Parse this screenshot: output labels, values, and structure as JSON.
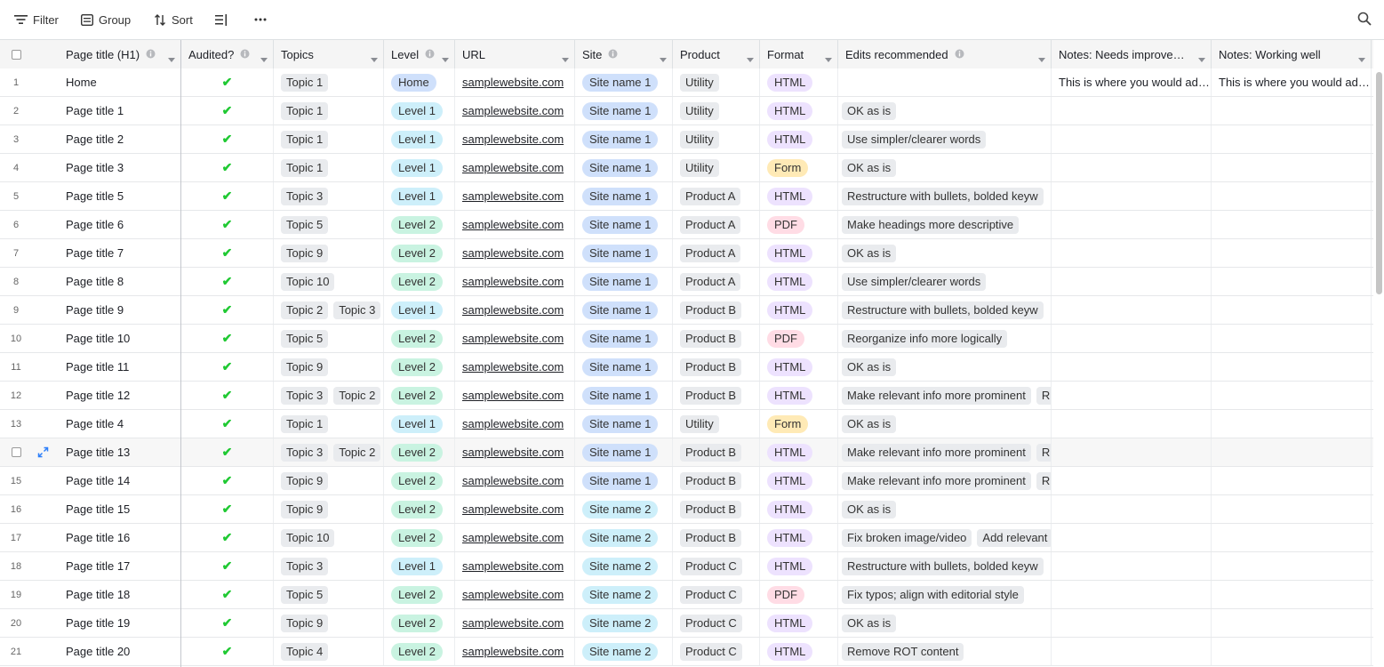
{
  "toolbar": {
    "filter_label": "Filter",
    "group_label": "Group",
    "sort_label": "Sort"
  },
  "columns": [
    {
      "key": "title",
      "label": "Page title (H1)",
      "info": true
    },
    {
      "key": "audited",
      "label": "Audited?",
      "info": true
    },
    {
      "key": "topics",
      "label": "Topics",
      "info": false
    },
    {
      "key": "level",
      "label": "Level",
      "info": true
    },
    {
      "key": "url",
      "label": "URL",
      "info": false
    },
    {
      "key": "site",
      "label": "Site",
      "info": true
    },
    {
      "key": "product",
      "label": "Product",
      "info": false
    },
    {
      "key": "format",
      "label": "Format",
      "info": false
    },
    {
      "key": "edits",
      "label": "Edits recommended",
      "info": true
    },
    {
      "key": "needs",
      "label": "Notes: Needs improvement",
      "info": false
    },
    {
      "key": "working",
      "label": "Notes: Working well",
      "info": false
    }
  ],
  "colors": {
    "level": {
      "Home": "#cfe0fb",
      "Level 1": "#cdeffa",
      "Level 2": "#c9f3e1"
    },
    "site": {
      "Site name 1": "#cfe0fb",
      "Site name 2": "#cdeffa"
    },
    "format": {
      "HTML": "#ede2fe",
      "PDF": "#ffdce5",
      "Form": "#ffeab6"
    },
    "check": "#20c933"
  },
  "rows": [
    {
      "num": "1",
      "title": "Home",
      "audited": true,
      "topics": [
        "Topic 1"
      ],
      "level": "Home",
      "url": "samplewebsite.com",
      "site": "Site name 1",
      "product": "Utility",
      "format": "HTML",
      "edits": [],
      "needs": "This is where you would add notes",
      "working": "This is where you would add notes"
    },
    {
      "num": "2",
      "title": "Page title 1",
      "audited": true,
      "topics": [
        "Topic 1"
      ],
      "level": "Level 1",
      "url": "samplewebsite.com",
      "site": "Site name 1",
      "product": "Utility",
      "format": "HTML",
      "edits": [
        "OK as is"
      ],
      "needs": "",
      "working": ""
    },
    {
      "num": "3",
      "title": "Page title 2",
      "audited": true,
      "topics": [
        "Topic 1"
      ],
      "level": "Level 1",
      "url": "samplewebsite.com",
      "site": "Site name 1",
      "product": "Utility",
      "format": "HTML",
      "edits": [
        "Use simpler/clearer words"
      ],
      "needs": "",
      "working": ""
    },
    {
      "num": "4",
      "title": "Page title 3",
      "audited": true,
      "topics": [
        "Topic 1"
      ],
      "level": "Level 1",
      "url": "samplewebsite.com",
      "site": "Site name 1",
      "product": "Utility",
      "format": "Form",
      "edits": [
        "OK as is"
      ],
      "needs": "",
      "working": ""
    },
    {
      "num": "5",
      "title": "Page title 5",
      "audited": true,
      "topics": [
        "Topic 3"
      ],
      "level": "Level 1",
      "url": "samplewebsite.com",
      "site": "Site name 1",
      "product": "Product A",
      "format": "HTML",
      "edits": [
        "Restructure with bullets, bolded keyw"
      ],
      "needs": "",
      "working": ""
    },
    {
      "num": "6",
      "title": "Page title 6",
      "audited": true,
      "topics": [
        "Topic 5"
      ],
      "level": "Level 2",
      "url": "samplewebsite.com",
      "site": "Site name 1",
      "product": "Product A",
      "format": "PDF",
      "edits": [
        "Make headings more descriptive"
      ],
      "needs": "",
      "working": ""
    },
    {
      "num": "7",
      "title": "Page title 7",
      "audited": true,
      "topics": [
        "Topic 9"
      ],
      "level": "Level 2",
      "url": "samplewebsite.com",
      "site": "Site name 1",
      "product": "Product A",
      "format": "HTML",
      "edits": [
        "OK as is"
      ],
      "needs": "",
      "working": ""
    },
    {
      "num": "8",
      "title": "Page title 8",
      "audited": true,
      "topics": [
        "Topic 10"
      ],
      "level": "Level 2",
      "url": "samplewebsite.com",
      "site": "Site name 1",
      "product": "Product A",
      "format": "HTML",
      "edits": [
        "Use simpler/clearer words"
      ],
      "needs": "",
      "working": ""
    },
    {
      "num": "9",
      "title": "Page title 9",
      "audited": true,
      "topics": [
        "Topic 2",
        "Topic 3"
      ],
      "level": "Level 1",
      "url": "samplewebsite.com",
      "site": "Site name 1",
      "product": "Product B",
      "format": "HTML",
      "edits": [
        "Restructure with bullets, bolded keyw"
      ],
      "needs": "",
      "working": ""
    },
    {
      "num": "10",
      "title": "Page title 10",
      "audited": true,
      "topics": [
        "Topic 5"
      ],
      "level": "Level 2",
      "url": "samplewebsite.com",
      "site": "Site name 1",
      "product": "Product B",
      "format": "PDF",
      "edits": [
        "Reorganize info more logically"
      ],
      "needs": "",
      "working": ""
    },
    {
      "num": "11",
      "title": "Page title 11",
      "audited": true,
      "topics": [
        "Topic 9"
      ],
      "level": "Level 2",
      "url": "samplewebsite.com",
      "site": "Site name 1",
      "product": "Product B",
      "format": "HTML",
      "edits": [
        "OK as is"
      ],
      "needs": "",
      "working": ""
    },
    {
      "num": "12",
      "title": "Page title 12",
      "audited": true,
      "topics": [
        "Topic 3",
        "Topic 2"
      ],
      "level": "Level 2",
      "url": "samplewebsite.com",
      "site": "Site name 1",
      "product": "Product B",
      "format": "HTML",
      "edits": [
        "Make relevant info more prominent",
        "R"
      ],
      "needs": "",
      "working": ""
    },
    {
      "num": "13",
      "title": "Page title 4",
      "audited": true,
      "topics": [
        "Topic 1"
      ],
      "level": "Level 1",
      "url": "samplewebsite.com",
      "site": "Site name 1",
      "product": "Utility",
      "format": "Form",
      "edits": [
        "OK as is"
      ],
      "needs": "",
      "working": ""
    },
    {
      "num": "",
      "title": "Page title 13",
      "audited": true,
      "topics": [
        "Topic 3",
        "Topic 2"
      ],
      "level": "Level 2",
      "url": "samplewebsite.com",
      "site": "Site name 1",
      "product": "Product B",
      "format": "HTML",
      "edits": [
        "Make relevant info more prominent",
        "R"
      ],
      "needs": "",
      "working": "",
      "hover": true
    },
    {
      "num": "15",
      "title": "Page title 14",
      "audited": true,
      "topics": [
        "Topic 9"
      ],
      "level": "Level 2",
      "url": "samplewebsite.com",
      "site": "Site name 1",
      "product": "Product B",
      "format": "HTML",
      "edits": [
        "Make relevant info more prominent",
        "R"
      ],
      "needs": "",
      "working": ""
    },
    {
      "num": "16",
      "title": "Page title 15",
      "audited": true,
      "topics": [
        "Topic 9"
      ],
      "level": "Level 2",
      "url": "samplewebsite.com",
      "site": "Site name 2",
      "product": "Product B",
      "format": "HTML",
      "edits": [
        "OK as is"
      ],
      "needs": "",
      "working": ""
    },
    {
      "num": "17",
      "title": "Page title 16",
      "audited": true,
      "topics": [
        "Topic 10"
      ],
      "level": "Level 2",
      "url": "samplewebsite.com",
      "site": "Site name 2",
      "product": "Product B",
      "format": "HTML",
      "edits": [
        "Fix broken image/video",
        "Add relevant"
      ],
      "needs": "",
      "working": ""
    },
    {
      "num": "18",
      "title": "Page title 17",
      "audited": true,
      "topics": [
        "Topic 3"
      ],
      "level": "Level 1",
      "url": "samplewebsite.com",
      "site": "Site name 2",
      "product": "Product C",
      "format": "HTML",
      "edits": [
        "Restructure with bullets, bolded keyw"
      ],
      "needs": "",
      "working": ""
    },
    {
      "num": "19",
      "title": "Page title 18",
      "audited": true,
      "topics": [
        "Topic 5"
      ],
      "level": "Level 2",
      "url": "samplewebsite.com",
      "site": "Site name 2",
      "product": "Product C",
      "format": "PDF",
      "edits": [
        "Fix typos; align with editorial style"
      ],
      "needs": "",
      "working": ""
    },
    {
      "num": "20",
      "title": "Page title 19",
      "audited": true,
      "topics": [
        "Topic 9"
      ],
      "level": "Level 2",
      "url": "samplewebsite.com",
      "site": "Site name 2",
      "product": "Product C",
      "format": "HTML",
      "edits": [
        "OK as is"
      ],
      "needs": "",
      "working": ""
    },
    {
      "num": "21",
      "title": "Page title 20",
      "audited": true,
      "topics": [
        "Topic 4"
      ],
      "level": "Level 2",
      "url": "samplewebsite.com",
      "site": "Site name 2",
      "product": "Product C",
      "format": "HTML",
      "edits": [
        "Remove ROT content"
      ],
      "needs": "",
      "working": ""
    }
  ]
}
